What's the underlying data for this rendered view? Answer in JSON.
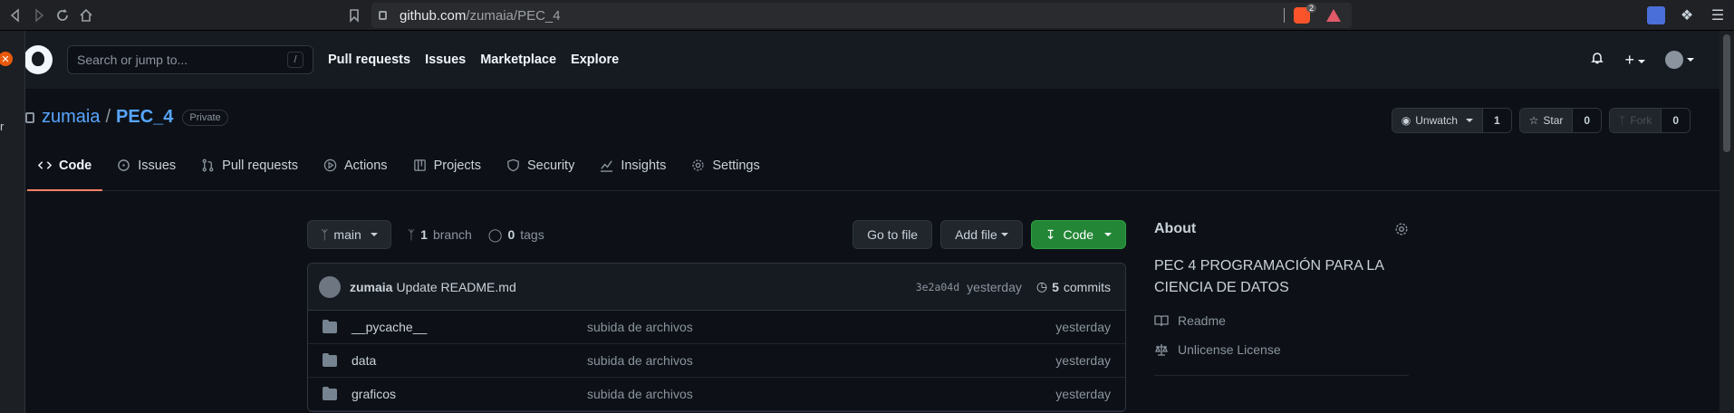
{
  "browser": {
    "url_host": "github.com",
    "url_path": "/zumaia/PEC_4",
    "brave_badge": "2"
  },
  "header": {
    "search_placeholder": "Search or jump to...",
    "search_shortcut": "/",
    "nav": [
      "Pull requests",
      "Issues",
      "Marketplace",
      "Explore"
    ]
  },
  "sidebar": {
    "partial_text": "r"
  },
  "repo": {
    "owner": "zumaia",
    "separator": "/",
    "name": "PEC_4",
    "visibility": "Private",
    "watch_label": "Unwatch",
    "watch_count": "1",
    "star_label": "Star",
    "star_count": "0",
    "fork_label": "Fork",
    "fork_count": "0"
  },
  "tabs": [
    {
      "label": "Code",
      "icon": "code-icon"
    },
    {
      "label": "Issues",
      "icon": "issue-icon"
    },
    {
      "label": "Pull requests",
      "icon": "pull-request-icon"
    },
    {
      "label": "Actions",
      "icon": "play-icon"
    },
    {
      "label": "Projects",
      "icon": "project-icon"
    },
    {
      "label": "Security",
      "icon": "shield-icon"
    },
    {
      "label": "Insights",
      "icon": "graph-icon"
    },
    {
      "label": "Settings",
      "icon": "gear-icon"
    }
  ],
  "toolbar": {
    "branch": "main",
    "branch_count": "1",
    "branch_label": "branch",
    "tag_count": "0",
    "tag_label": "tags",
    "go_to_file": "Go to file",
    "add_file": "Add file",
    "code": "Code"
  },
  "commit": {
    "user": "zumaia",
    "message": "Update README.md",
    "sha": "3e2a04d",
    "when": "yesterday",
    "count": "5",
    "count_label": "commits"
  },
  "files": [
    {
      "name": "__pycache__",
      "message": "subida de archivos",
      "date": "yesterday"
    },
    {
      "name": "data",
      "message": "subida de archivos",
      "date": "yesterday"
    },
    {
      "name": "graficos",
      "message": "subida de archivos",
      "date": "yesterday"
    }
  ],
  "about": {
    "title": "About",
    "description": "PEC 4 PROGRAMACIÓN PARA LA CIENCIA DE DATOS",
    "readme": "Readme",
    "license": "Unlicense License"
  },
  "colors": {
    "accent_blue": "#58a6ff",
    "green_button": "#238636",
    "active_tab": "#f78166"
  }
}
